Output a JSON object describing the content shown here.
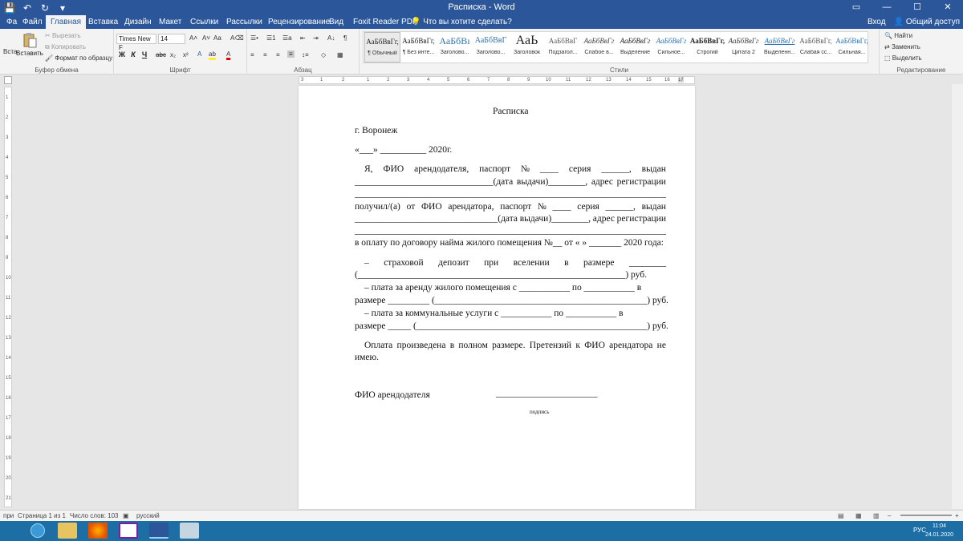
{
  "titlebar": {
    "title": "Расписка - Word",
    "qat_save": "💾",
    "qat_undo": "↶",
    "qat_redo": "↻",
    "min": "—",
    "max": "☐",
    "close": "✕"
  },
  "tabs": {
    "items": [
      "Фа",
      "Файл",
      "Главная",
      "Вставка",
      "Дизайн",
      "Макет",
      "Ссылки",
      "Рассылки",
      "Рецензирование",
      "Вид",
      "Foxit Reader PDF",
      "Что вы хотите сделать?"
    ],
    "login": "Вход",
    "share": "Общий доступ"
  },
  "ribbon": {
    "clipboard": {
      "paste": "Вставить",
      "cut": "Вырезать",
      "copy": "Копировать",
      "format_painter": "Формат по образцу",
      "label": "Буфер обмена",
      "paste_small": "Вста"
    },
    "font": {
      "name": "Times New F",
      "size": "14",
      "label": "Шрифт",
      "bold": "Ж",
      "italic": "К",
      "underline": "Ч",
      "strike": "abc",
      "sub": "x₂",
      "sup": "x²",
      "aa": "Aa"
    },
    "paragraph": {
      "label": "Абзац"
    },
    "styles": {
      "label": "Стили",
      "items": [
        {
          "preview": "АаБбВвГг,",
          "name": "¶ Обычный"
        },
        {
          "preview": "АаБбВвГг,",
          "name": "¶ Без инте..."
        },
        {
          "preview": "АаБбВı",
          "name": "Заголово..."
        },
        {
          "preview": "АаБбВвГ",
          "name": "Заголово..."
        },
        {
          "preview": "АаЬ",
          "name": "Заголовок"
        },
        {
          "preview": "АаБбВвГ",
          "name": "Подзагол..."
        },
        {
          "preview": "АаБбВвГг",
          "name": "Слабое в..."
        },
        {
          "preview": "АаБбВвГг",
          "name": "Выделение"
        },
        {
          "preview": "АаБбВвГг",
          "name": "Сильное..."
        },
        {
          "preview": "АаБбВвГг,",
          "name": "Строгий"
        },
        {
          "preview": "АаБбВвГг",
          "name": "Цитата 2"
        },
        {
          "preview": "АаБбВвГг",
          "name": "Выделенн..."
        },
        {
          "preview": "АаБбВвГг,",
          "name": "Слабая сс..."
        },
        {
          "preview": "АаБбВвГг,",
          "name": "Сильная..."
        }
      ]
    },
    "editing": {
      "find": "Найти",
      "replace": "Заменить",
      "select": "Выделить",
      "label": "Редактирование"
    }
  },
  "ruler": {
    "h_ticks": [
      "3",
      "1",
      "2",
      "1",
      "1",
      "2",
      "3",
      "4",
      "5",
      "6",
      "7",
      "8",
      "9",
      "10",
      "11",
      "12",
      "13",
      "14",
      "15",
      "16",
      "17"
    ],
    "v_ticks": [
      "1",
      "2",
      "3",
      "4",
      "5",
      "6",
      "7",
      "8",
      "9",
      "10",
      "11",
      "12",
      "13",
      "14",
      "15",
      "16",
      "17",
      "18",
      "19",
      "20",
      "21"
    ]
  },
  "document": {
    "title": "Расписка",
    "city": "г. Воронеж",
    "date": "«___» __________ 2020г.",
    "p1_l1": [
      "Я,",
      "ФИО",
      "арендодателя,",
      "паспорт",
      "№",
      "____",
      "серия",
      "______,",
      "выдан"
    ],
    "p1_l2": [
      "______________________________(дата",
      "выдачи)________,",
      "адрес",
      "регистрации"
    ],
    "p1_l3": "_____________________________________________________________________,",
    "p1_l4": [
      "получил/(а)",
      "от",
      "ФИО",
      "арендатора,",
      "паспорт",
      "№",
      "____",
      "серия",
      "______,",
      "выдан"
    ],
    "p1_l5": [
      "_______________________________(дата",
      "выдачи)________,",
      "адрес",
      "регистрации"
    ],
    "p1_l6": "_____________________________________________________________________,",
    "p1_l7": "в оплату по договору найма жилого помещения №__ от « » _______ 2020 года:",
    "b1_l1": [
      "–",
      "страховой",
      "депозит",
      "при",
      "вселении",
      "в",
      "размере",
      "________"
    ],
    "b1_l2": "(__________________________________________________________) руб.",
    "b2_l1": "–    плата за аренду жилого помещения с ___________ по ___________ в",
    "b2_l2": "размере _________ (______________________________________________) руб.",
    "b3_l1": "–    плата за коммунальные услуги с ___________ по ___________ в",
    "b3_l2": "размере _____ (__________________________________________________) руб.",
    "p2_l1": [
      "Оплата",
      "произведена",
      "в",
      "полном",
      "размере.",
      "Претензий",
      "к",
      "ФИО",
      "арендатора",
      "не"
    ],
    "p2_l2": "имею.",
    "sign_label": "ФИО арендодателя",
    "sign_line": "______________________",
    "sign_caption": "подпись"
  },
  "statusbar": {
    "left": "при",
    "page": "Страница 1 из 1",
    "words": "Число слов: 103",
    "lang": "русский",
    "zoom_minus": "–",
    "zoom_plus": "+"
  },
  "taskbar": {
    "lang": "РУС",
    "time": "11:04",
    "date": "24.01.2020"
  },
  "colors": {
    "word_blue": "#2b579a",
    "taskbar": "#1c6ea4"
  }
}
